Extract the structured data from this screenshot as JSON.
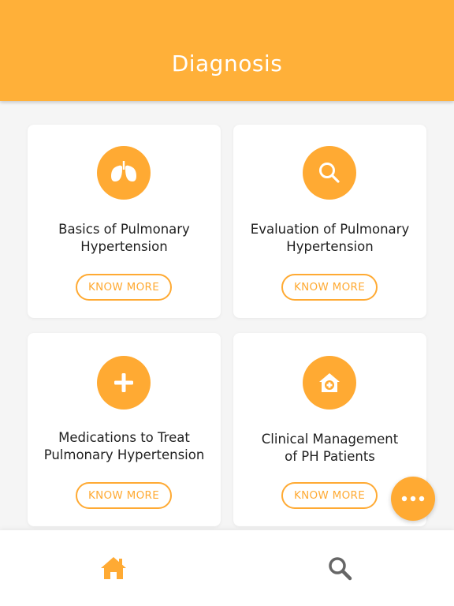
{
  "header": {
    "title": "Diagnosis"
  },
  "cards": [
    {
      "title_lines": [
        "Basics of Pulmonary",
        "Hypertension"
      ],
      "button_label": "KNOW MORE",
      "icon": "lungs-icon"
    },
    {
      "title_lines": [
        "Evaluation of Pulmonary",
        "Hypertension"
      ],
      "button_label": "KNOW MORE",
      "icon": "magnifier-icon"
    },
    {
      "title_lines": [
        "Medications to Treat",
        "Pulmonary Hypertension"
      ],
      "button_label": "KNOW MORE",
      "icon": "plus-icon"
    },
    {
      "title_lines": [
        "Clinical Management",
        "of PH Patients"
      ],
      "button_label": "KNOW MORE",
      "icon": "hospital-icon"
    }
  ],
  "fab": {
    "icon": "more-dots-icon"
  },
  "bottom_nav": {
    "items": [
      {
        "icon": "home-icon",
        "active": true
      },
      {
        "icon": "search-icon",
        "active": false
      }
    ]
  },
  "colors": {
    "accent": "#ffaa33",
    "header": "#ffb039",
    "background": "#f5f5f5",
    "inactive_icon": "#666666"
  }
}
